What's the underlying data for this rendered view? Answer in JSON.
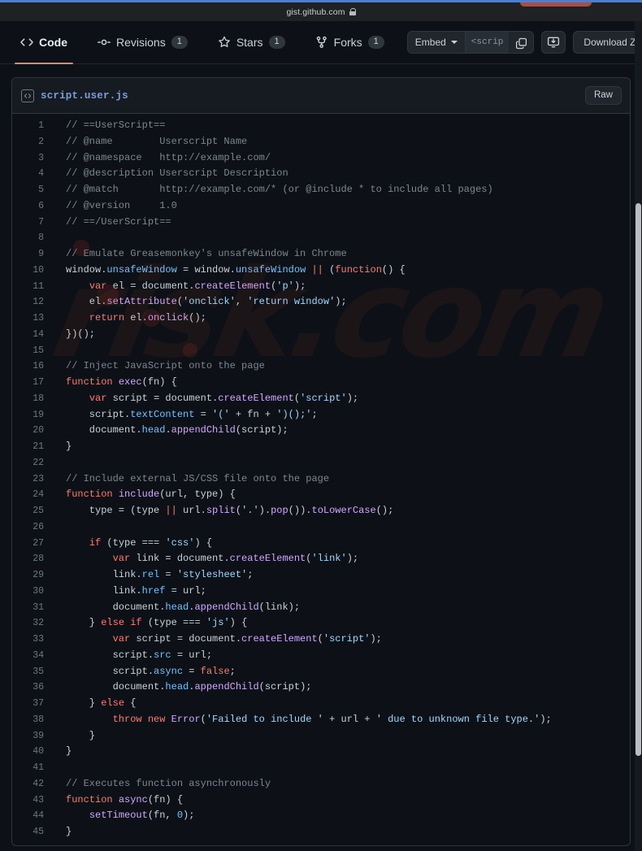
{
  "browser": {
    "url": "gist.github.com",
    "lock_icon": "lock-icon"
  },
  "toolbar": {
    "tabs": [
      {
        "label": "Code",
        "icon": "code-icon",
        "count": null,
        "active": true
      },
      {
        "label": "Revisions",
        "icon": "revisions-icon",
        "count": "1",
        "active": false
      },
      {
        "label": "Stars",
        "icon": "star-icon",
        "count": "1",
        "active": false
      },
      {
        "label": "Forks",
        "icon": "fork-icon",
        "count": "1",
        "active": false
      }
    ],
    "embed_label": "Embed",
    "embed_value": "<scrip",
    "copy_icon": "copy-icon",
    "clone_icon": "clone-download-icon",
    "download_zip_label": "Download ZIP"
  },
  "file": {
    "icon": "file-code-icon",
    "name": "script.user.js",
    "raw_label": "Raw"
  },
  "code": {
    "lines": [
      {
        "n": "1",
        "tokens": [
          [
            "c",
            "// ==UserScript=="
          ]
        ]
      },
      {
        "n": "2",
        "tokens": [
          [
            "c",
            "// @name        Userscript Name"
          ]
        ]
      },
      {
        "n": "3",
        "tokens": [
          [
            "c",
            "// @namespace   http://example.com/"
          ]
        ]
      },
      {
        "n": "4",
        "tokens": [
          [
            "c",
            "// @description Userscript Description"
          ]
        ]
      },
      {
        "n": "5",
        "tokens": [
          [
            "c",
            "// @match       http://example.com/* (or @include * to include all pages)"
          ]
        ]
      },
      {
        "n": "6",
        "tokens": [
          [
            "c",
            "// @version     1.0"
          ]
        ]
      },
      {
        "n": "7",
        "tokens": [
          [
            "c",
            "// ==/UserScript=="
          ]
        ]
      },
      {
        "n": "8",
        "tokens": []
      },
      {
        "n": "9",
        "tokens": [
          [
            "c",
            "// Emulate Greasemonkey's unsafeWindow in Chrome"
          ]
        ]
      },
      {
        "n": "10",
        "tokens": [
          [
            "pl",
            "window."
          ],
          [
            "v",
            "unsafeWindow"
          ],
          [
            "pl",
            " = window."
          ],
          [
            "v",
            "unsafeWindow"
          ],
          [
            "pl",
            " "
          ],
          [
            "k",
            "||"
          ],
          [
            "pl",
            " ("
          ],
          [
            "k",
            "function"
          ],
          [
            "pl",
            "() {"
          ]
        ]
      },
      {
        "n": "11",
        "tokens": [
          [
            "pl",
            "    "
          ],
          [
            "k",
            "var"
          ],
          [
            "pl",
            " el = document."
          ],
          [
            "p",
            "createElement"
          ],
          [
            "pl",
            "("
          ],
          [
            "s",
            "'p'"
          ],
          [
            "pl",
            ");"
          ]
        ]
      },
      {
        "n": "12",
        "tokens": [
          [
            "pl",
            "    el."
          ],
          [
            "p",
            "setAttribute"
          ],
          [
            "pl",
            "("
          ],
          [
            "s",
            "'onclick'"
          ],
          [
            "pl",
            ", "
          ],
          [
            "s",
            "'return window'"
          ],
          [
            "pl",
            ");"
          ]
        ]
      },
      {
        "n": "13",
        "tokens": [
          [
            "pl",
            "    "
          ],
          [
            "k",
            "return"
          ],
          [
            "pl",
            " el."
          ],
          [
            "p",
            "onclick"
          ],
          [
            "pl",
            "();"
          ]
        ]
      },
      {
        "n": "14",
        "tokens": [
          [
            "pl",
            "})();"
          ]
        ]
      },
      {
        "n": "15",
        "tokens": []
      },
      {
        "n": "16",
        "tokens": [
          [
            "c",
            "// Inject JavaScript onto the page"
          ]
        ]
      },
      {
        "n": "17",
        "tokens": [
          [
            "k",
            "function"
          ],
          [
            "pl",
            " "
          ],
          [
            "p",
            "exec"
          ],
          [
            "pl",
            "(fn) {"
          ]
        ]
      },
      {
        "n": "18",
        "tokens": [
          [
            "pl",
            "    "
          ],
          [
            "k",
            "var"
          ],
          [
            "pl",
            " script = document."
          ],
          [
            "p",
            "createElement"
          ],
          [
            "pl",
            "("
          ],
          [
            "s",
            "'script'"
          ],
          [
            "pl",
            ");"
          ]
        ]
      },
      {
        "n": "19",
        "tokens": [
          [
            "pl",
            "    script."
          ],
          [
            "v",
            "textContent"
          ],
          [
            "pl",
            " = "
          ],
          [
            "s",
            "'('"
          ],
          [
            "pl",
            " + fn + "
          ],
          [
            "s",
            "')();'"
          ],
          [
            "pl",
            ";"
          ]
        ]
      },
      {
        "n": "20",
        "tokens": [
          [
            "pl",
            "    document."
          ],
          [
            "v",
            "head"
          ],
          [
            "pl",
            "."
          ],
          [
            "p",
            "appendChild"
          ],
          [
            "pl",
            "(script);"
          ]
        ]
      },
      {
        "n": "21",
        "tokens": [
          [
            "pl",
            "}"
          ]
        ]
      },
      {
        "n": "22",
        "tokens": []
      },
      {
        "n": "23",
        "tokens": [
          [
            "c",
            "// Include external JS/CSS file onto the page"
          ]
        ]
      },
      {
        "n": "24",
        "tokens": [
          [
            "k",
            "function"
          ],
          [
            "pl",
            " "
          ],
          [
            "p",
            "include"
          ],
          [
            "pl",
            "(url, type) {"
          ]
        ]
      },
      {
        "n": "25",
        "tokens": [
          [
            "pl",
            "    type = (type "
          ],
          [
            "k",
            "||"
          ],
          [
            "pl",
            " url."
          ],
          [
            "p",
            "split"
          ],
          [
            "pl",
            "("
          ],
          [
            "s",
            "'.'"
          ],
          [
            "pl",
            ")."
          ],
          [
            "p",
            "pop"
          ],
          [
            "pl",
            "())."
          ],
          [
            "p",
            "toLowerCase"
          ],
          [
            "pl",
            "();"
          ]
        ]
      },
      {
        "n": "26",
        "tokens": []
      },
      {
        "n": "27",
        "tokens": [
          [
            "pl",
            "    "
          ],
          [
            "k",
            "if"
          ],
          [
            "pl",
            " (type === "
          ],
          [
            "s",
            "'css'"
          ],
          [
            "pl",
            ") {"
          ]
        ]
      },
      {
        "n": "28",
        "tokens": [
          [
            "pl",
            "        "
          ],
          [
            "k",
            "var"
          ],
          [
            "pl",
            " link = document."
          ],
          [
            "p",
            "createElement"
          ],
          [
            "pl",
            "("
          ],
          [
            "s",
            "'link'"
          ],
          [
            "pl",
            ");"
          ]
        ]
      },
      {
        "n": "29",
        "tokens": [
          [
            "pl",
            "        link."
          ],
          [
            "v",
            "rel"
          ],
          [
            "pl",
            " = "
          ],
          [
            "s",
            "'stylesheet'"
          ],
          [
            "pl",
            ";"
          ]
        ]
      },
      {
        "n": "30",
        "tokens": [
          [
            "pl",
            "        link."
          ],
          [
            "v",
            "href"
          ],
          [
            "pl",
            " = url;"
          ]
        ]
      },
      {
        "n": "31",
        "tokens": [
          [
            "pl",
            "        document."
          ],
          [
            "v",
            "head"
          ],
          [
            "pl",
            "."
          ],
          [
            "p",
            "appendChild"
          ],
          [
            "pl",
            "(link);"
          ]
        ]
      },
      {
        "n": "32",
        "tokens": [
          [
            "pl",
            "    } "
          ],
          [
            "k",
            "else if"
          ],
          [
            "pl",
            " (type === "
          ],
          [
            "s",
            "'js'"
          ],
          [
            "pl",
            ") {"
          ]
        ]
      },
      {
        "n": "33",
        "tokens": [
          [
            "pl",
            "        "
          ],
          [
            "k",
            "var"
          ],
          [
            "pl",
            " script = document."
          ],
          [
            "p",
            "createElement"
          ],
          [
            "pl",
            "("
          ],
          [
            "s",
            "'script'"
          ],
          [
            "pl",
            ");"
          ]
        ]
      },
      {
        "n": "34",
        "tokens": [
          [
            "pl",
            "        script."
          ],
          [
            "v",
            "src"
          ],
          [
            "pl",
            " = url;"
          ]
        ]
      },
      {
        "n": "35",
        "tokens": [
          [
            "pl",
            "        script."
          ],
          [
            "v",
            "async"
          ],
          [
            "pl",
            " = "
          ],
          [
            "k",
            "false"
          ],
          [
            "pl",
            ";"
          ]
        ]
      },
      {
        "n": "36",
        "tokens": [
          [
            "pl",
            "        document."
          ],
          [
            "v",
            "head"
          ],
          [
            "pl",
            "."
          ],
          [
            "p",
            "appendChild"
          ],
          [
            "pl",
            "(script);"
          ]
        ]
      },
      {
        "n": "37",
        "tokens": [
          [
            "pl",
            "    } "
          ],
          [
            "k",
            "else"
          ],
          [
            "pl",
            " {"
          ]
        ]
      },
      {
        "n": "38",
        "tokens": [
          [
            "pl",
            "        "
          ],
          [
            "k",
            "throw"
          ],
          [
            "pl",
            " "
          ],
          [
            "k",
            "new"
          ],
          [
            "pl",
            " "
          ],
          [
            "p",
            "Error"
          ],
          [
            "pl",
            "("
          ],
          [
            "s",
            "'Failed to include '"
          ],
          [
            "pl",
            " + url + "
          ],
          [
            "s",
            "' due to unknown file type.'"
          ],
          [
            "pl",
            ");"
          ]
        ]
      },
      {
        "n": "39",
        "tokens": [
          [
            "pl",
            "    }"
          ]
        ]
      },
      {
        "n": "40",
        "tokens": [
          [
            "pl",
            "}"
          ]
        ]
      },
      {
        "n": "41",
        "tokens": []
      },
      {
        "n": "42",
        "tokens": [
          [
            "c",
            "// Executes function asynchronously"
          ]
        ]
      },
      {
        "n": "43",
        "tokens": [
          [
            "k",
            "function"
          ],
          [
            "pl",
            " "
          ],
          [
            "p",
            "async"
          ],
          [
            "pl",
            "(fn) {"
          ]
        ]
      },
      {
        "n": "44",
        "tokens": [
          [
            "pl",
            "    "
          ],
          [
            "p",
            "setTimeout"
          ],
          [
            "pl",
            "(fn, "
          ],
          [
            "v",
            "0"
          ],
          [
            "pl",
            ");"
          ]
        ]
      },
      {
        "n": "45",
        "tokens": [
          [
            "pl",
            "}"
          ]
        ]
      }
    ]
  },
  "watermark": {
    "text": "risk.com"
  },
  "colors": {
    "page_bg": "#0d1117",
    "panel_bg": "#161b22",
    "border": "#30363d",
    "accent_tab": "#d98b6a",
    "link": "#7d9bdd",
    "comment": "#7d8590",
    "keyword": "#ff7b72",
    "string": "#a5d6ff",
    "function": "#d2a8ff",
    "constant": "#79c0ff",
    "progress_bar": "#4a7fd4"
  }
}
